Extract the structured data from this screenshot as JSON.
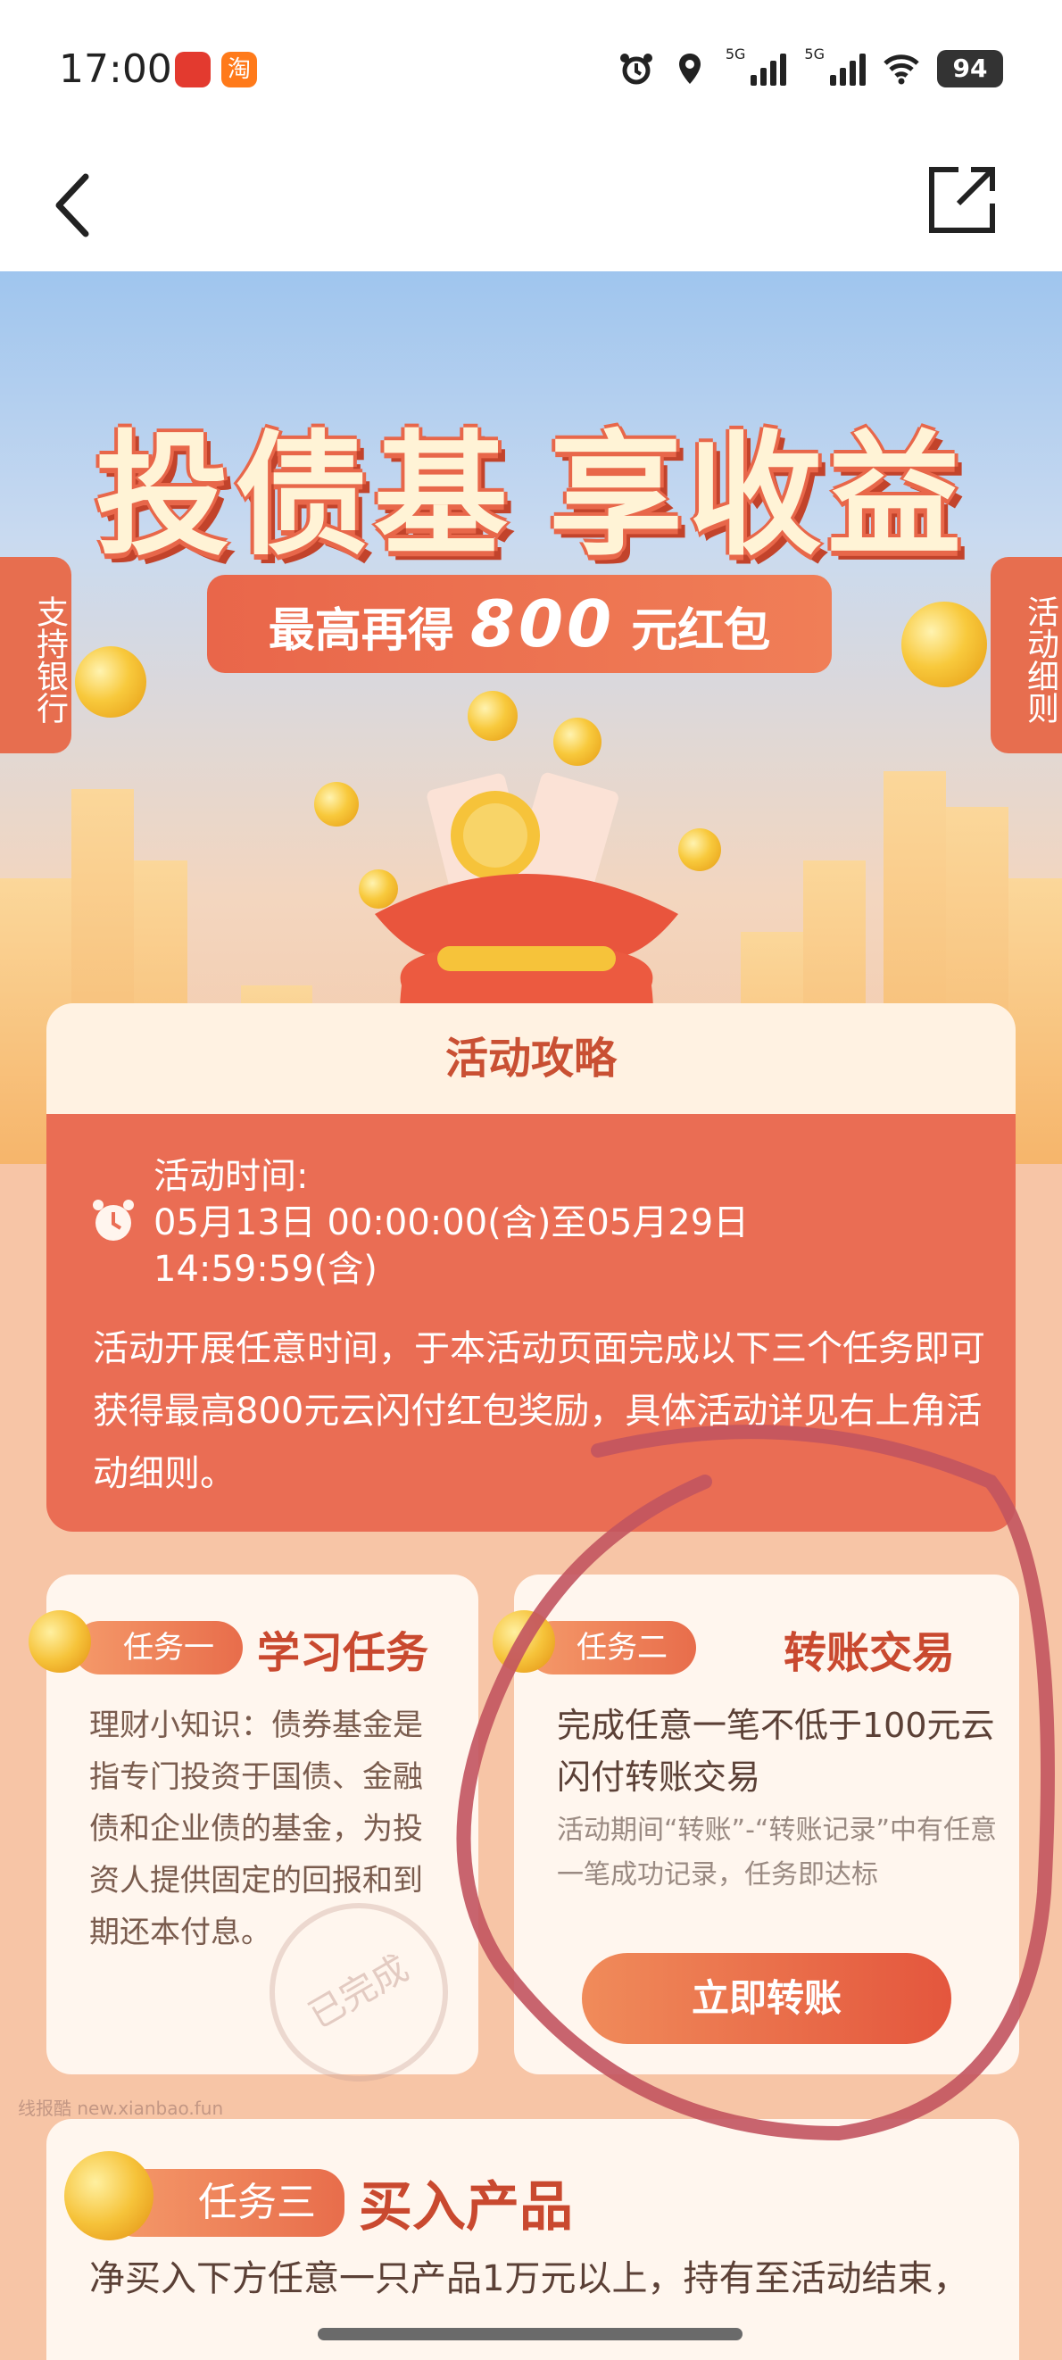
{
  "status_bar": {
    "time": "17:00",
    "app_icon_taobao": "淘",
    "net_1": "5G",
    "net_2": "5G",
    "battery": "94"
  },
  "hero": {
    "title_left": "投债基",
    "title_right": "享收益",
    "subtitle_prefix": "最高再得",
    "subtitle_amount": "800",
    "subtitle_suffix": "元红包",
    "left_tag": "支持银行",
    "right_tag": "活动细则"
  },
  "strategy": {
    "header": "活动攻略",
    "time_label": "活动时间:",
    "time_range": "05月13日 00:00:00(含)至05月29日 14:59:59(含)",
    "description": "活动开展任意时间，于本活动页面完成以下三个任务即可获得最高800元云闪付红包奖励，具体活动详见右上角活动细则。"
  },
  "task1": {
    "pill": "任务一",
    "title": "学习任务",
    "text": "理财小知识：债券基金是指专门投资于国债、金融债和企业债的基金，为投资人提供固定的回报和到期还本付息。",
    "stamp": "已完成"
  },
  "task2": {
    "pill": "任务二",
    "title": "转账交易",
    "main": "完成任意一笔不低于100元云闪付转账交易",
    "sub": "活动期间“转账”-“转账记录”中有任意一笔成功记录，任务即达标",
    "button": "立即转账"
  },
  "task3": {
    "pill": "任务三",
    "title": "买入产品",
    "main": "净买入下方任意一只产品1万元以上，持有至活动结束，"
  },
  "watermark": "线报酷 new.xianbao.fun",
  "colors": {
    "accent": "#ea6d54",
    "card_bg": "#fff6ee",
    "title_red": "#c9492f",
    "page_bg": "#f7c5a6"
  }
}
